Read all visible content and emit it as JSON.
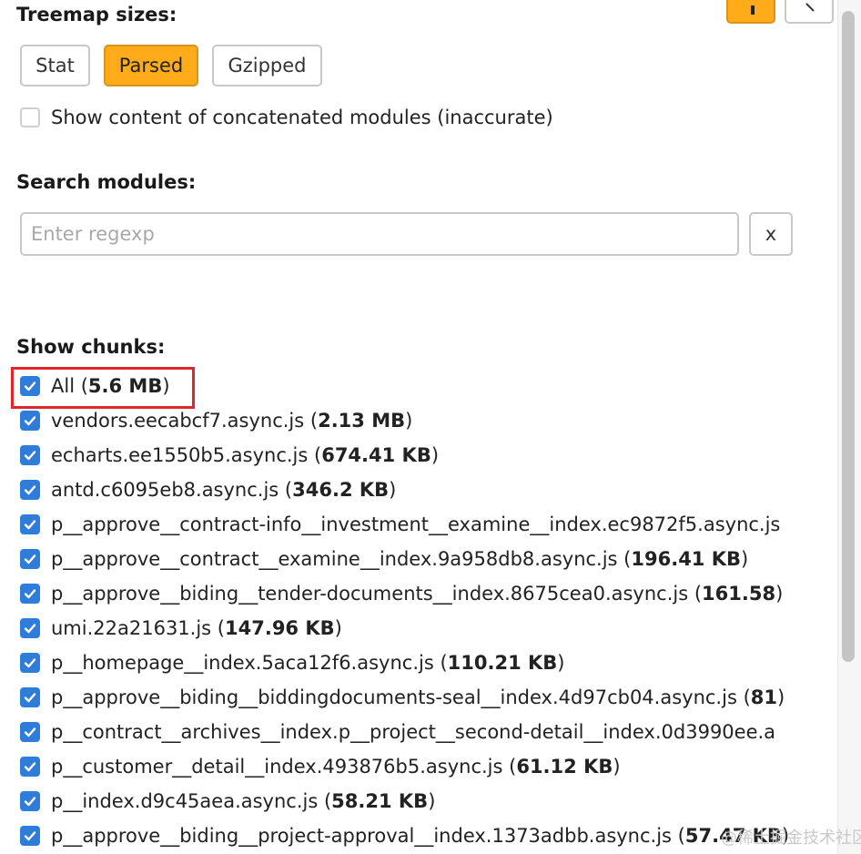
{
  "sidebar": {
    "treemap_heading": "Treemap sizes:",
    "size_buttons": {
      "stat": "Stat",
      "parsed": "Parsed",
      "gzipped": "Gzipped"
    },
    "active_size": "Parsed",
    "concat_label": "Show content of concatenated modules (inaccurate)",
    "concat_checked": false,
    "search_heading": "Search modules:",
    "search_placeholder": "Enter regexp",
    "search_value": "",
    "clear_label": "x",
    "chunks_heading": "Show chunks:",
    "all_chunk": {
      "label": "All",
      "size": "5.6 MB"
    },
    "chunks": [
      {
        "name": "vendors.eecabcf7.async.js",
        "size": "2.13 MB"
      },
      {
        "name": "echarts.ee1550b5.async.js",
        "size": "674.41 KB"
      },
      {
        "name": "antd.c6095eb8.async.js",
        "size": "346.2 KB"
      },
      {
        "name": "p__approve__contract-info__investment__examine__index.ec9872f5.async.js",
        "size": ""
      },
      {
        "name": "p__approve__contract__examine__index.9a958db8.async.js",
        "size": "196.41 KB"
      },
      {
        "name": "p__approve__biding__tender-documents__index.8675cea0.async.js",
        "size": "161.58"
      },
      {
        "name": "umi.22a21631.js",
        "size": "147.96 KB"
      },
      {
        "name": "p__homepage__index.5aca12f6.async.js",
        "size": "110.21 KB"
      },
      {
        "name": "p__approve__biding__biddingdocuments-seal__index.4d97cb04.async.js",
        "size": "81"
      },
      {
        "name": "p__contract__archives__index.p__project__second-detail__index.0d3990ee.a",
        "size": ""
      },
      {
        "name": "p__customer__detail__index.493876b5.async.js",
        "size": "61.12 KB"
      },
      {
        "name": "p__index.d9c45aea.async.js",
        "size": "58.21 KB"
      },
      {
        "name": "p__approve__biding__project-approval__index.1373adbb.async.js",
        "size": "57.47 KB"
      }
    ],
    "watermark": "@稀土掘金技术社区",
    "colors": {
      "accent": "#ffab1a",
      "checkbox": "#2f7dd9",
      "highlight": "#e0262b"
    }
  }
}
